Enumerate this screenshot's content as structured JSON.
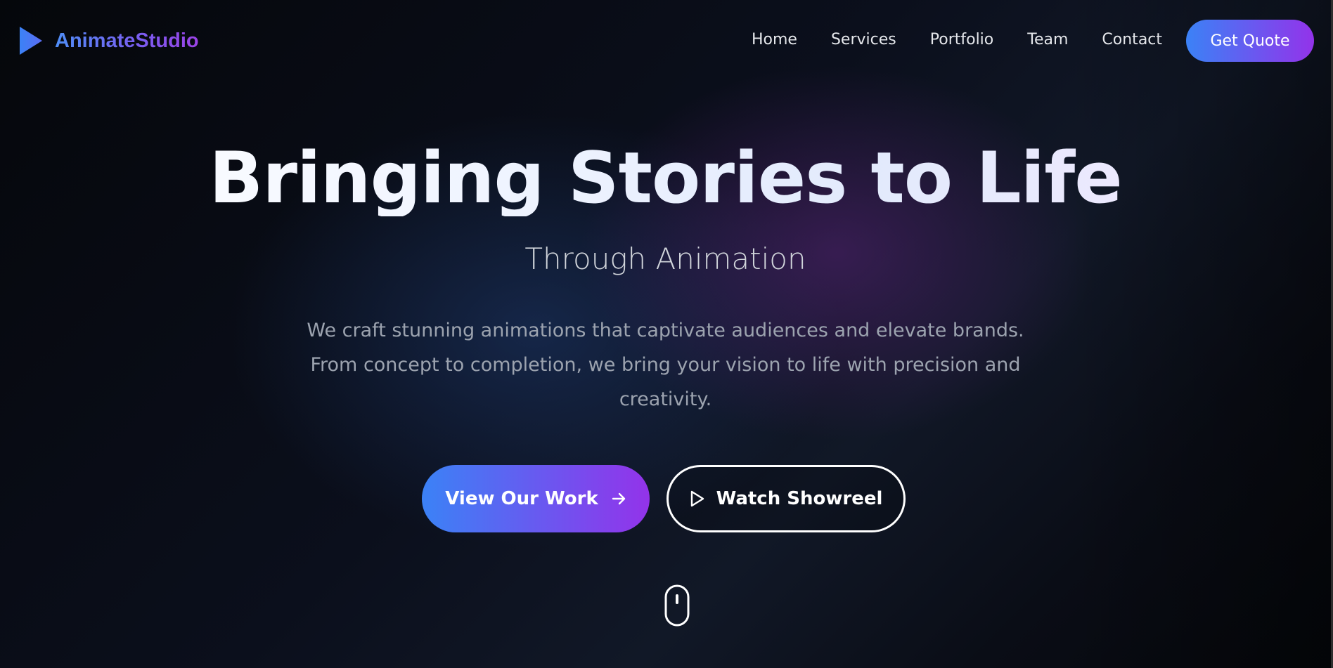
{
  "brand": {
    "name": "AnimateStudio",
    "logo_icon": "play-triangle-icon"
  },
  "nav": {
    "items": [
      {
        "label": "Home"
      },
      {
        "label": "Services"
      },
      {
        "label": "Portfolio"
      },
      {
        "label": "Team"
      },
      {
        "label": "Contact"
      }
    ],
    "cta_label": "Get Quote"
  },
  "hero": {
    "title": "Bringing Stories to Life",
    "subtitle": "Through Animation",
    "description": "We craft stunning animations that captivate audiences and elevate brands. From concept to completion, we bring your vision to life with precision and creativity.",
    "primary_button": {
      "label": "View Our Work",
      "icon": "arrow-right-icon"
    },
    "secondary_button": {
      "label": "Watch Showreel",
      "icon": "play-outline-icon"
    },
    "scroll_indicator_icon": "mouse-scroll-icon"
  },
  "colors": {
    "accent_start": "#3b82f6",
    "accent_end": "#9333ea",
    "background": "#05070d",
    "nav_text": "#e5e7eb",
    "description_text": "#9ca3af"
  }
}
